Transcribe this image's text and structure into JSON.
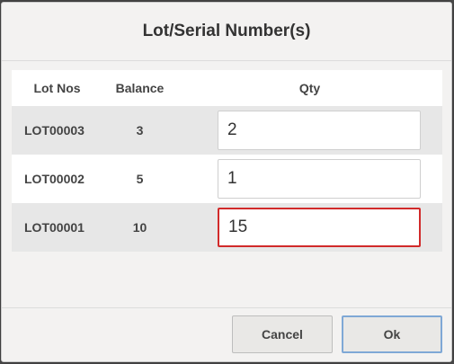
{
  "dialog": {
    "title": "Lot/Serial Number(s)"
  },
  "table": {
    "headers": {
      "lot": "Lot Nos",
      "balance": "Balance",
      "qty": "Qty"
    },
    "rows": [
      {
        "lot": "LOT00003",
        "balance": "3",
        "qty": "2"
      },
      {
        "lot": "LOT00002",
        "balance": "5",
        "qty": "1"
      },
      {
        "lot": "LOT00001",
        "balance": "10",
        "qty": "15"
      }
    ],
    "error_row": 2,
    "error_color": "#d12a2a"
  },
  "footer": {
    "cancel_label": "Cancel",
    "ok_label": "Ok"
  }
}
